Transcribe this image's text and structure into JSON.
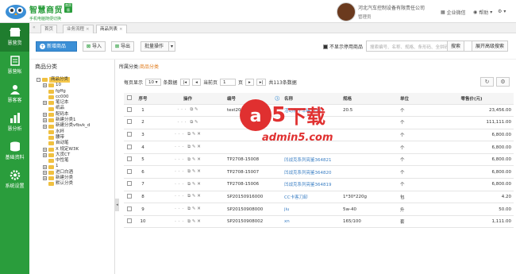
{
  "app": {
    "brand_name": "智慧商贸",
    "brand_sub": "手机电脑随便切换",
    "brand_badge": "商贸版",
    "company_name": "河北汽车控制设备有限责任公司",
    "user": "管理员",
    "help_label": "帮助",
    "service_label": "企业微信"
  },
  "colors": {
    "brand_green": "#2a9d3c",
    "primary_blue": "#3b8fd6",
    "link": "#3b7fc4",
    "selected": "#f7c94c"
  },
  "sidebar": {
    "items": [
      {
        "label": "慧营货",
        "icon": "shop-icon"
      },
      {
        "label": "慧营帐",
        "icon": "ledger-icon"
      },
      {
        "label": "慧客客",
        "icon": "customer-icon"
      },
      {
        "label": "慧分析",
        "icon": "chart-icon"
      },
      {
        "label": "基础资料",
        "icon": "database-icon"
      },
      {
        "label": "系统设置",
        "icon": "settings-icon"
      }
    ]
  },
  "tabs": [
    {
      "label": "首页"
    },
    {
      "label": "业务流程"
    },
    {
      "label": "商品列表"
    }
  ],
  "toolbar": {
    "add_label": "新增商品",
    "import_label": "导入",
    "export_label": "导出",
    "batch_label": "批量操作",
    "show_disabled_label": "不显示停用商品",
    "search_placeholder": "搜索编号、名称、规格、条形码、全拼码",
    "search_label": "搜索",
    "advanced_label": "展开高级搜索"
  },
  "tree": {
    "title": "商品分类",
    "nodes": [
      {
        "label": "商品分类",
        "depth": 0,
        "toggle": "-",
        "selected": true
      },
      {
        "label": "10",
        "depth": 1,
        "toggle": "+"
      },
      {
        "label": "fgffg",
        "depth": 1,
        "toggle": ""
      },
      {
        "label": "cc000",
        "depth": 1,
        "toggle": ""
      },
      {
        "label": "笔记本",
        "depth": 1,
        "toggle": "+"
      },
      {
        "label": "纸品",
        "depth": 1,
        "toggle": ""
      },
      {
        "label": "配码本",
        "depth": 1,
        "toggle": "+"
      },
      {
        "label": "新建分类1",
        "depth": 1,
        "toggle": "+"
      },
      {
        "label": "新建分类vfbvk_d",
        "depth": 1,
        "toggle": "+"
      },
      {
        "label": "水杯",
        "depth": 1,
        "toggle": ""
      },
      {
        "label": "腰带",
        "depth": 1,
        "toggle": ""
      },
      {
        "label": "自动笔",
        "depth": 1,
        "toggle": ""
      },
      {
        "label": "X 规定W3K",
        "depth": 1,
        "toggle": "+"
      },
      {
        "label": "大货CT",
        "depth": 1,
        "toggle": "+"
      },
      {
        "label": "中性笔",
        "depth": 1,
        "toggle": ""
      },
      {
        "label": "1",
        "depth": 1,
        "toggle": "+"
      },
      {
        "label": "进口白酒",
        "depth": 1,
        "toggle": "+"
      },
      {
        "label": "新建分类",
        "depth": 1,
        "toggle": "+"
      },
      {
        "label": "默认分类",
        "depth": 1,
        "toggle": ""
      }
    ]
  },
  "main": {
    "breadcrumb_prefix": "所属分类:",
    "breadcrumb_current": "商品分类"
  },
  "pager": {
    "per_page_prefix": "每页显示",
    "per_page": "10",
    "per_page_suffix": "条数据",
    "current_prefix": "当前页",
    "current": "1",
    "total_prefix": "页",
    "total_text": "共113条数据"
  },
  "table": {
    "headers": {
      "seq": "序号",
      "ops": "操作",
      "code": "编号",
      "name": "名称",
      "spec": "规格",
      "unit": "单位",
      "price": "零售价(元)"
    },
    "rows": [
      {
        "seq": "1",
        "code": "test20150901",
        "name": "活动表子车罐1111",
        "spec": "20.5",
        "unit": "个",
        "price": "23,456.00",
        "short": true
      },
      {
        "seq": "2",
        "code": "",
        "name": "",
        "spec": "",
        "unit": "个",
        "price": "111,111.00",
        "short": true
      },
      {
        "seq": "3",
        "code": "",
        "name": "",
        "spec": "",
        "unit": "个",
        "price": "6,800.00",
        "short": false
      },
      {
        "seq": "4",
        "code": "",
        "name": "",
        "spec": "",
        "unit": "个",
        "price": "6,800.00",
        "short": false
      },
      {
        "seq": "5",
        "code": "TP2708-15008",
        "name": "凹战克系列亮鉴364821",
        "spec": "",
        "unit": "个",
        "price": "6,800.00",
        "short": false
      },
      {
        "seq": "6",
        "code": "TP2708-15007",
        "name": "凹战克系列亮鉴364820",
        "spec": "",
        "unit": "个",
        "price": "6,800.00",
        "short": false
      },
      {
        "seq": "7",
        "code": "TP2708-15006",
        "name": "凹战克系列亮鉴364819",
        "spec": "",
        "unit": "个",
        "price": "6,800.00",
        "short": false
      },
      {
        "seq": "8",
        "code": "SP20150916000",
        "name": "CC卡客刀卸",
        "spec": "1*30*220g",
        "unit": "包",
        "price": "4.20",
        "short": false
      },
      {
        "seq": "9",
        "code": "SP20150908000",
        "name": "jiu",
        "spec": "5w-40",
        "unit": "升",
        "price": "50.00",
        "short": false
      },
      {
        "seq": "10",
        "code": "SP20150908002",
        "name": "xn",
        "spec": "165/100",
        "unit": "套",
        "price": "1,111.00",
        "short": false
      }
    ]
  }
}
